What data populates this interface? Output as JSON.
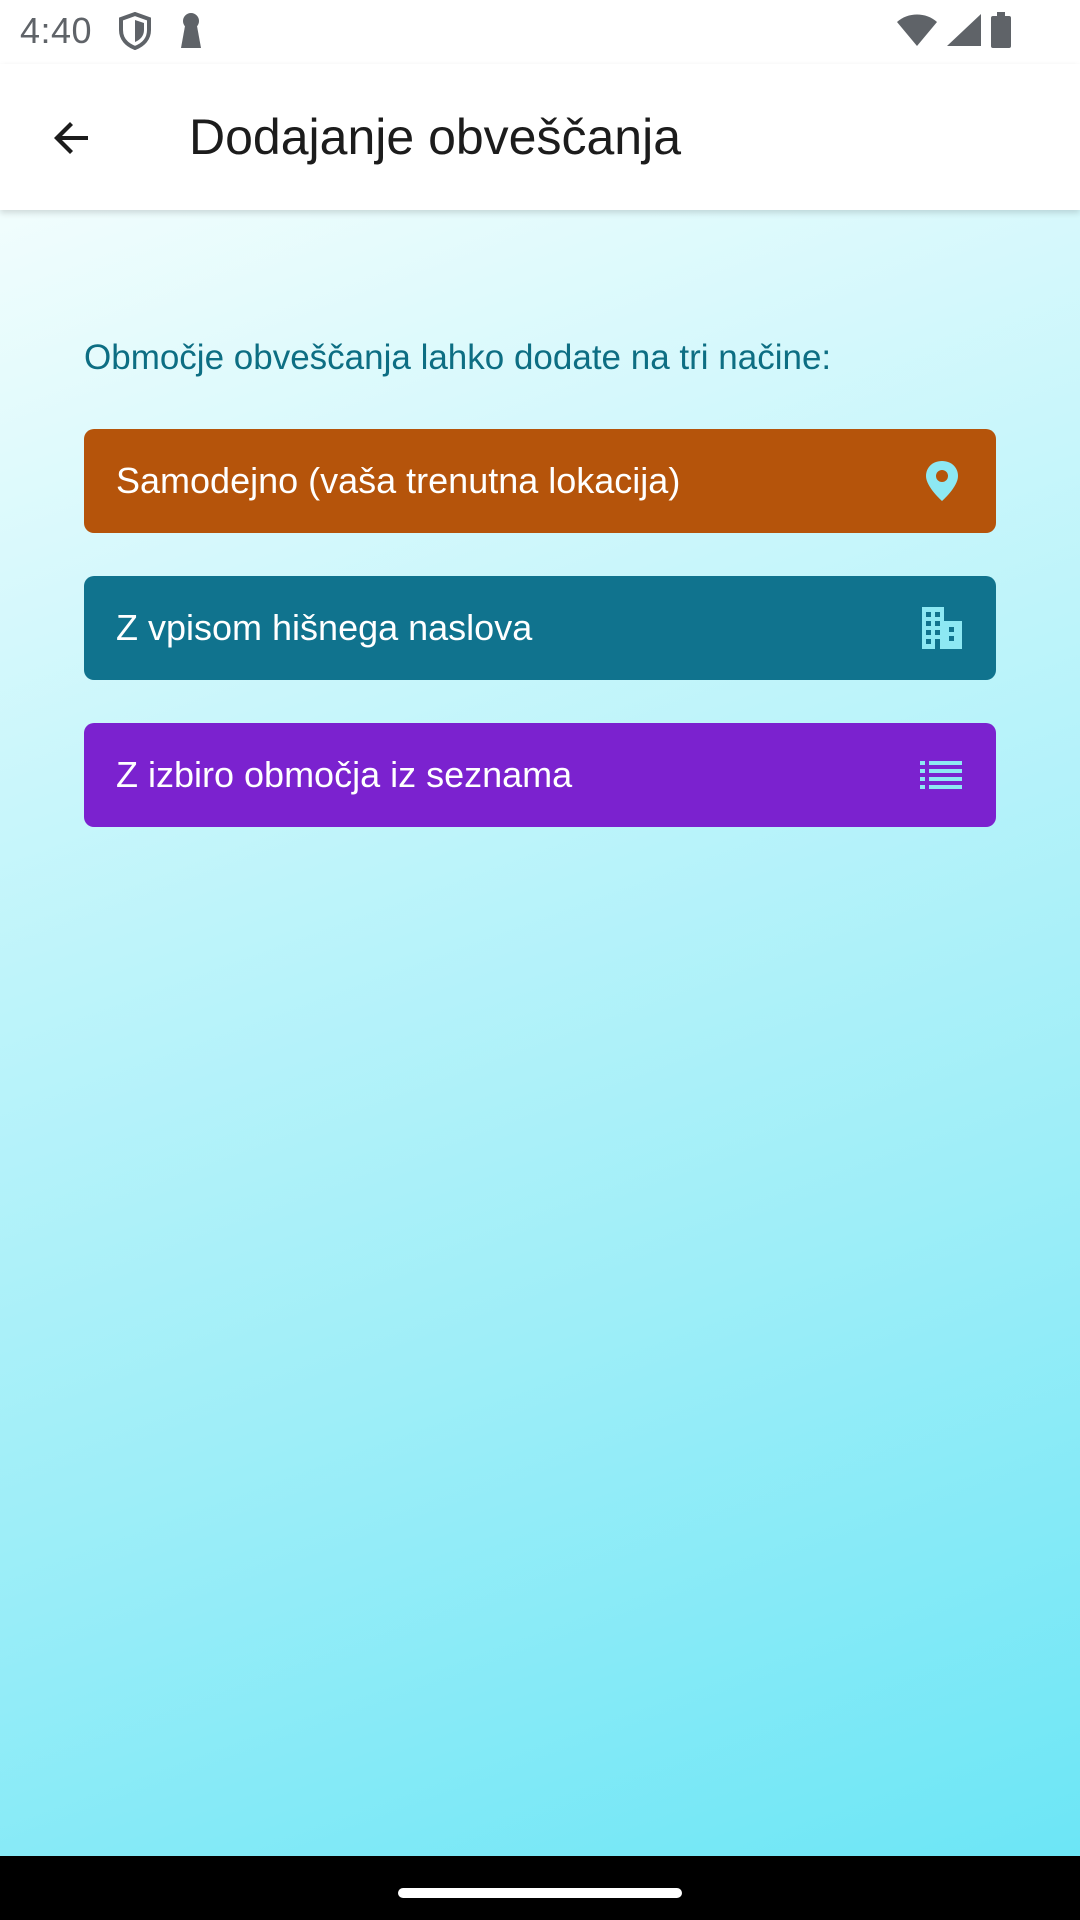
{
  "status_bar": {
    "time": "4:40",
    "left_icons": [
      "shield-icon",
      "keyhole-icon"
    ],
    "right_icons": [
      "wifi-icon",
      "cell-signal-icon",
      "battery-icon"
    ]
  },
  "app_bar": {
    "title": "Dodajanje obveščanja",
    "back_icon": "arrow-back-icon"
  },
  "content": {
    "intro": "Območje obveščanja lahko dodate na tri načine:",
    "options": [
      {
        "label": "Samodejno (vaša trenutna lokacija)",
        "icon": "location-pin-icon",
        "color": "#b5540b"
      },
      {
        "label": "Z vpisom hišnega naslova",
        "icon": "building-icon",
        "color": "#10738e"
      },
      {
        "label": "Z izbiro območja iz seznama",
        "icon": "list-icon",
        "color": "#7b22cf"
      }
    ]
  },
  "colors": {
    "icon_accent": "#8de8f3",
    "title_text": "#1c1c1c",
    "intro_text": "#0d6e83"
  }
}
